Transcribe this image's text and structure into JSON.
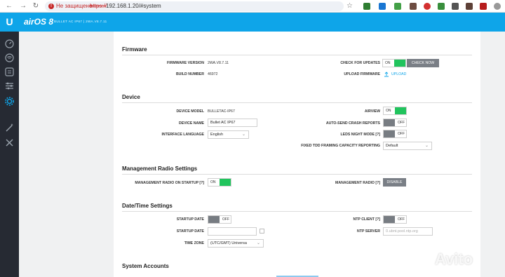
{
  "browser": {
    "security_warning": "Не защищено",
    "url_scheme": "https://",
    "url_rest": "192.168.1.20/#system"
  },
  "header": {
    "brand": "airOS 8",
    "subtitle": "BULLET AC IP67 | 2WA.V8.7.11"
  },
  "sidebar": {
    "logo": "U",
    "items": [
      "dashboard-icon",
      "wireless-icon",
      "network-icon",
      "services-icon",
      "system-icon",
      "tools-icon",
      "wrench-icon"
    ]
  },
  "firmware": {
    "title": "Firmware",
    "version_label": "FIRMWARE VERSION",
    "version_value": "2WA.V8.7.11",
    "build_label": "BUILD NUMBER",
    "build_value": "46972",
    "check_label": "CHECK FOR UPDATES",
    "check_toggle": "ON",
    "check_now": "CHECK NOW",
    "upload_label": "UPLOAD FIRMWARE",
    "upload_link": "UPLOAD"
  },
  "device": {
    "title": "Device",
    "model_label": "DEVICE MODEL",
    "model_value": "BULLETAC-IP67",
    "name_label": "DEVICE NAME",
    "name_value": "Bullet AC IP67",
    "language_label": "INTERFACE LANGUAGE",
    "language_value": "English",
    "airview_label": "AIRVIEW",
    "airview_toggle": "ON",
    "crash_label": "AUTO-SEND CRASH REPORTS",
    "crash_toggle": "OFF",
    "leds_label": "LEDS NIGHT MODE [?]",
    "leds_toggle": "OFF",
    "tdd_label": "FIXED TDD FRAMING CAPACITY REPORTING",
    "tdd_value": "Default"
  },
  "management": {
    "title": "Management Radio Settings",
    "startup_label": "MANAGEMENT RADIO ON STARTUP [?]",
    "startup_toggle": "ON",
    "radio_label": "MANAGEMENT RADIO [?]",
    "radio_button": "DISABLE"
  },
  "datetime": {
    "title": "Date/Time Settings",
    "startup_date_label": "STARTUP DATE",
    "startup_date_toggle": "OFF",
    "startup_date2_label": "STARTUP DATE",
    "startup_date2_value": "",
    "timezone_label": "TIME ZONE",
    "timezone_value": "(UTC/GMT) Universa",
    "ntp_client_label": "NTP CLIENT [?]",
    "ntp_client_toggle": "OFF",
    "ntp_server_label": "NTP SERVER",
    "ntp_server_placeholder": "0.ubnt.pool.ntp.org"
  },
  "accounts": {
    "title": "System Accounts"
  },
  "watermark": "Avito",
  "colors": {
    "accent": "#0ea5e9",
    "toggle_on": "#21c45d",
    "toggle_off": "#777c82",
    "sidebar": "#262a33"
  }
}
